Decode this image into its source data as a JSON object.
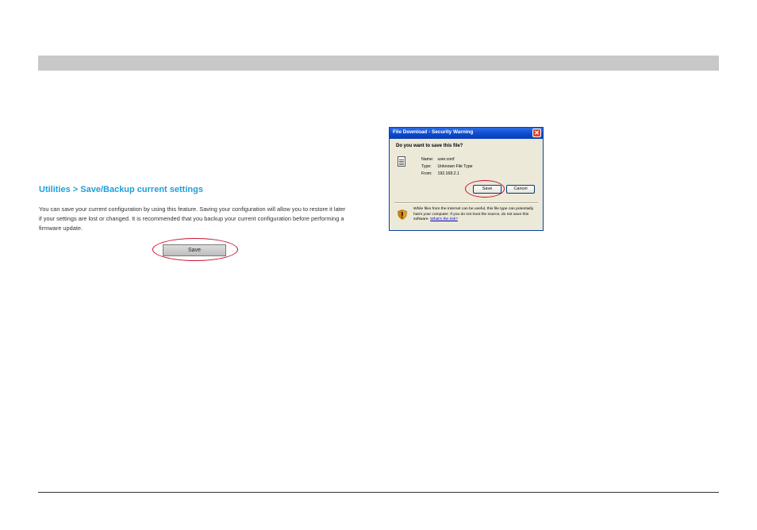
{
  "left_panel": {
    "section_title": "Utilities > Save/Backup current settings",
    "description": "You can save your current configuration by using this feature. Saving your configuration will allow you to restore it later if your settings are lost or changed. It is recommended that you backup your current configuration before performing a firmware update.",
    "save_label": "Save"
  },
  "dialog": {
    "title": "File Download - Security Warning",
    "close_glyph": "✕",
    "question": "Do you want to save this file?",
    "file_icon": "document-icon",
    "name_label": "Name:",
    "name_value": "user.conf",
    "type_label": "Type:",
    "type_value": "Unknown File Type",
    "from_label": "From:",
    "from_value": "192.168.2.1",
    "save_label": "Save",
    "cancel_label": "Cancel",
    "warning_icon": "shield-icon",
    "warning_text": "While files from the Internet can be useful, this file type can potentially harm your computer. If you do not trust the source, do not save this software.",
    "risk_link": "What's the risk?"
  },
  "colors": {
    "section_title": "#1e9fdc",
    "highlight_ellipse": "#c8102e",
    "top_bar": "#c8c8c8",
    "dialog_title_bar": "#0b48cc"
  }
}
